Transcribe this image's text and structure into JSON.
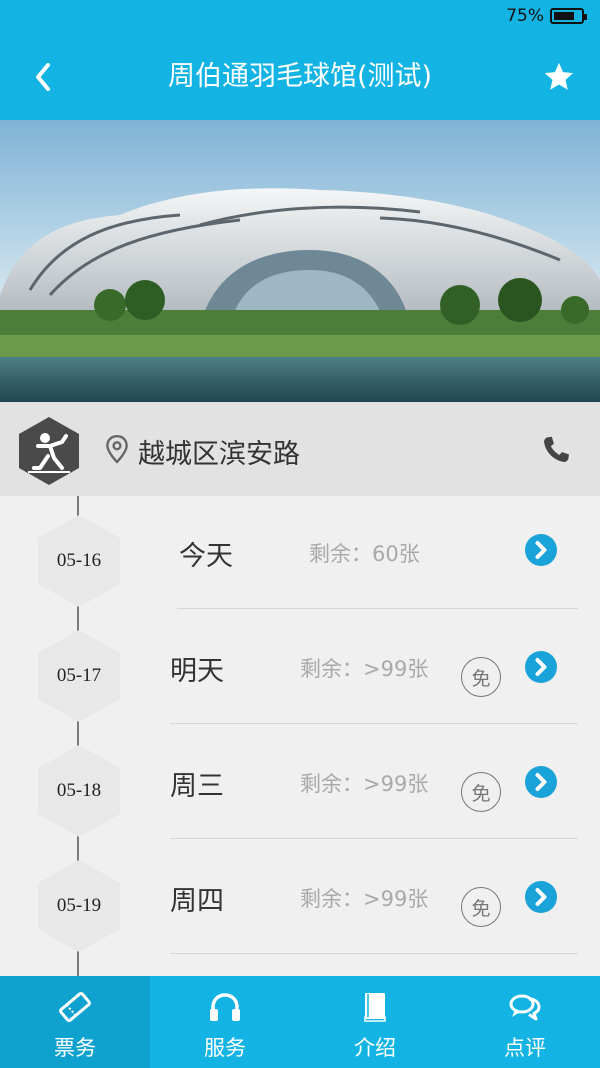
{
  "status_bar": {
    "battery_text": "75%",
    "battery_level": 0.75
  },
  "header": {
    "title": "周伯通羽毛球馆(测试)"
  },
  "venue": {
    "address": "越城区滨安路"
  },
  "schedule": [
    {
      "date": "05-16",
      "day": "今天",
      "remaining": "剩余：60张",
      "free": false
    },
    {
      "date": "05-17",
      "day": "明天",
      "remaining": "剩余：>99张",
      "free": true,
      "free_label": "免"
    },
    {
      "date": "05-18",
      "day": "周三",
      "remaining": "剩余：>99张",
      "free": true,
      "free_label": "免"
    },
    {
      "date": "05-19",
      "day": "周四",
      "remaining": "剩余：>99张",
      "free": true,
      "free_label": "免"
    }
  ],
  "tabs": [
    {
      "label": "票务",
      "icon": "ticket-icon",
      "active": true
    },
    {
      "label": "服务",
      "icon": "headset-icon",
      "active": false
    },
    {
      "label": "介绍",
      "icon": "book-icon",
      "active": false
    },
    {
      "label": "点评",
      "icon": "chat-icon",
      "active": false
    }
  ],
  "colors": {
    "accent": "#13b3e3",
    "accent_active": "#0fa2cf",
    "arrow": "#1aa3d8"
  }
}
